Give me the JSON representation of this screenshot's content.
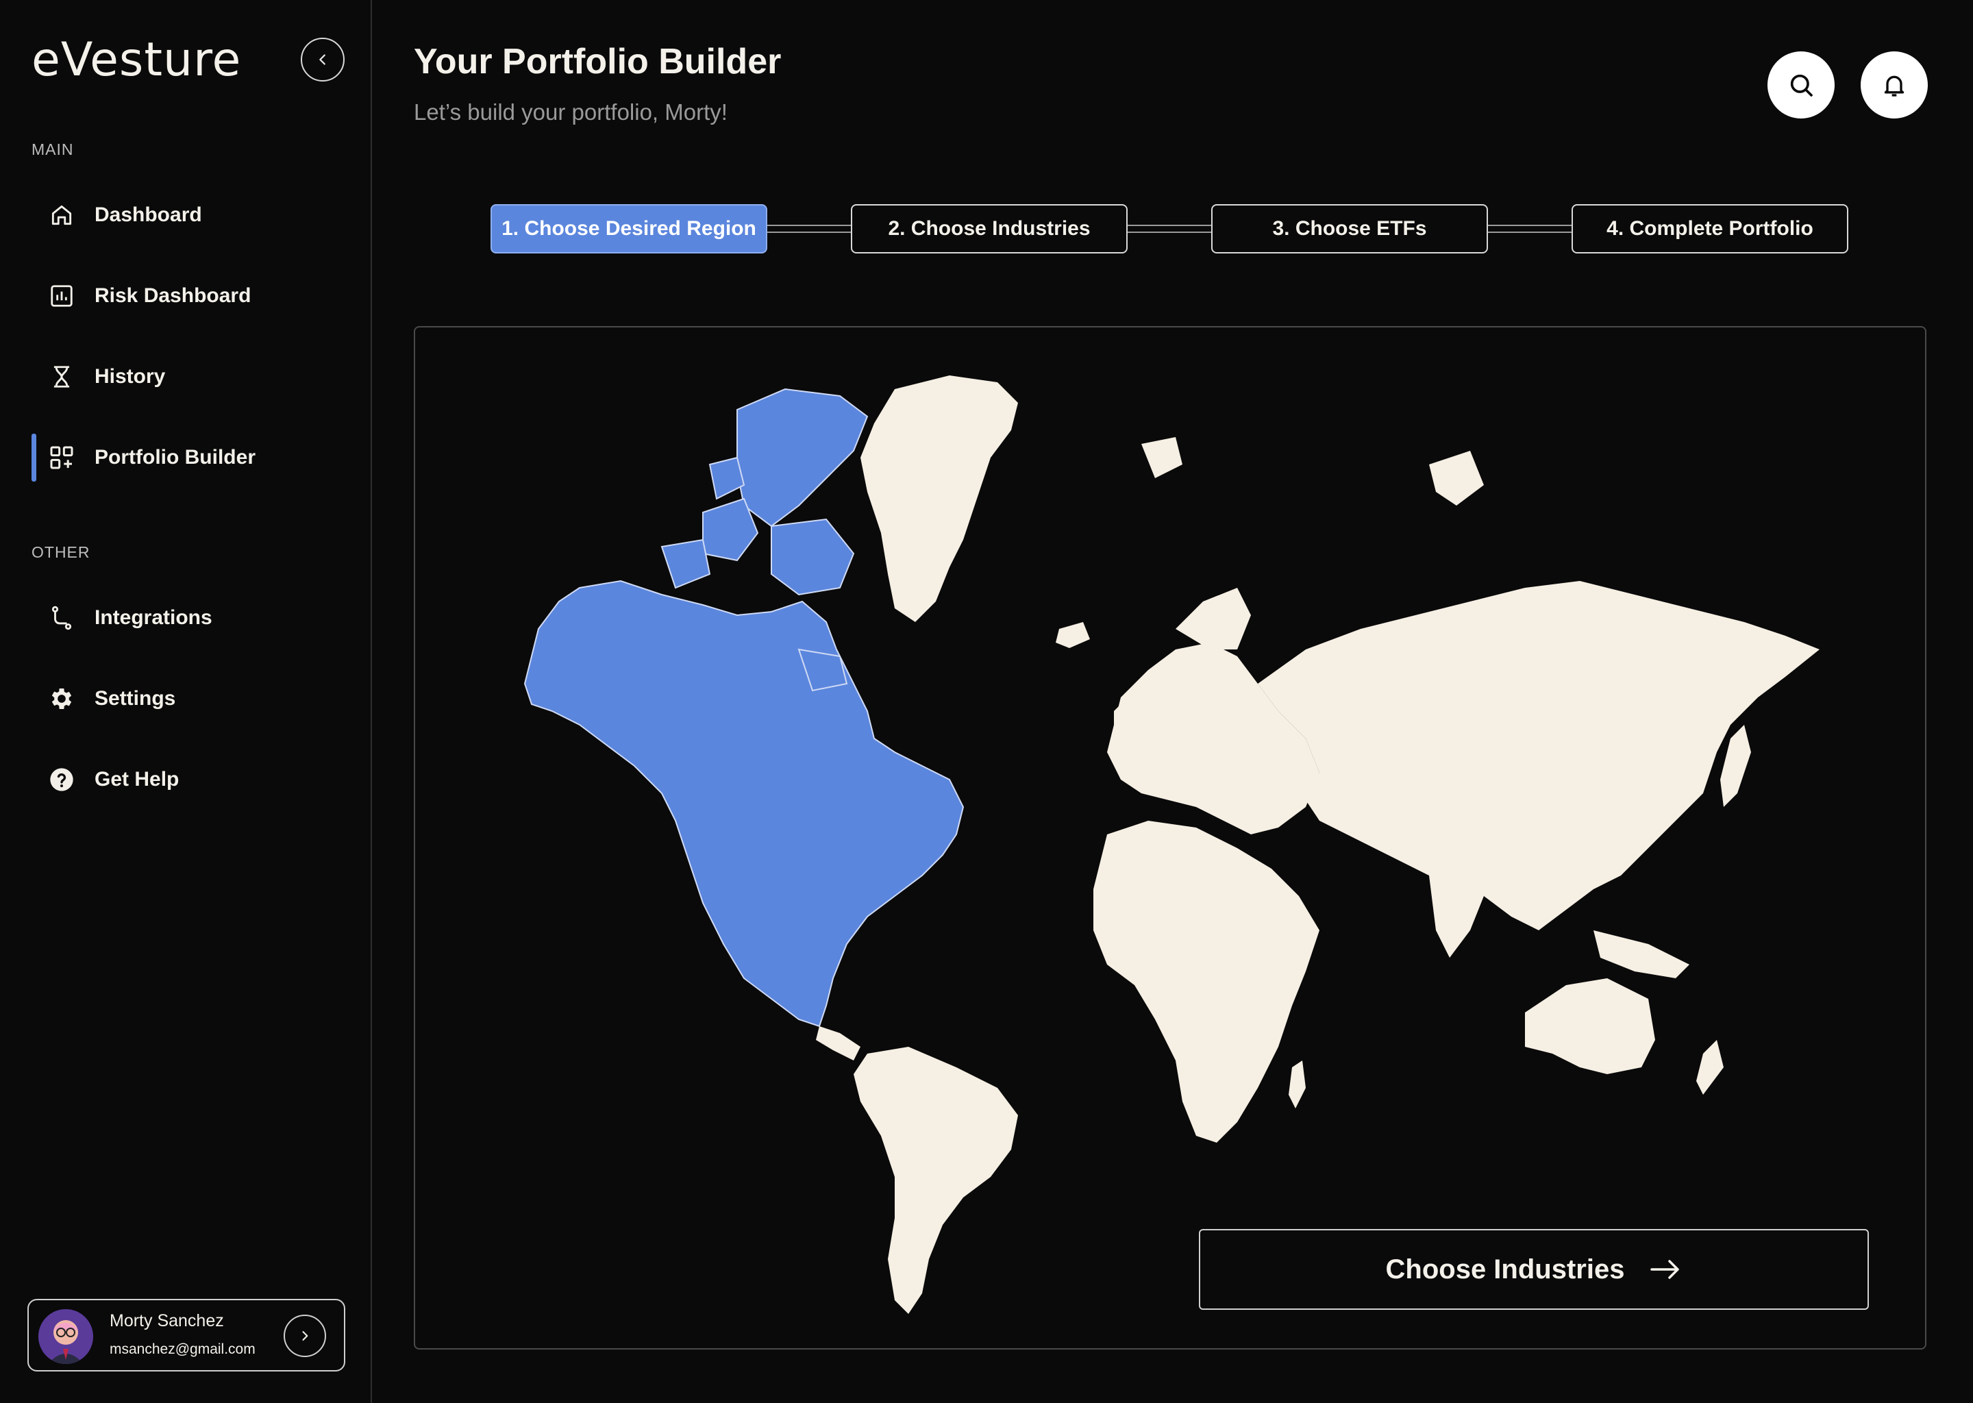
{
  "app": {
    "logo": "eVesture"
  },
  "sidebar": {
    "sections": {
      "main": "MAIN",
      "other": "OTHER"
    },
    "main_items": [
      {
        "label": "Dashboard",
        "icon": "home-icon"
      },
      {
        "label": "Risk Dashboard",
        "icon": "bar-chart-icon"
      },
      {
        "label": "History",
        "icon": "hourglass-icon"
      },
      {
        "label": "Portfolio Builder",
        "icon": "grid-plus-icon",
        "active": true
      }
    ],
    "other_items": [
      {
        "label": "Integrations",
        "icon": "route-icon"
      },
      {
        "label": "Settings",
        "icon": "gear-icon"
      },
      {
        "label": "Get Help",
        "icon": "help-circle-icon"
      }
    ],
    "user": {
      "name": "Morty Sanchez",
      "email": "msanchez@gmail.com"
    }
  },
  "header": {
    "title": "Your Portfolio Builder",
    "subtitle": "Let’s build your portfolio, Morty!"
  },
  "stepper": {
    "steps": [
      {
        "label": "1. Choose Desired Region",
        "active": true
      },
      {
        "label": "2. Choose Industries",
        "active": false
      },
      {
        "label": "3. Choose ETFs",
        "active": false
      },
      {
        "label": "4. Complete Portfolio",
        "active": false
      }
    ]
  },
  "map": {
    "selected_region": "North America",
    "colors": {
      "selected": "#5b86dd",
      "land": "#f6efe4",
      "background": "#0a0a0a"
    }
  },
  "cta": {
    "label": "Choose Industries"
  }
}
